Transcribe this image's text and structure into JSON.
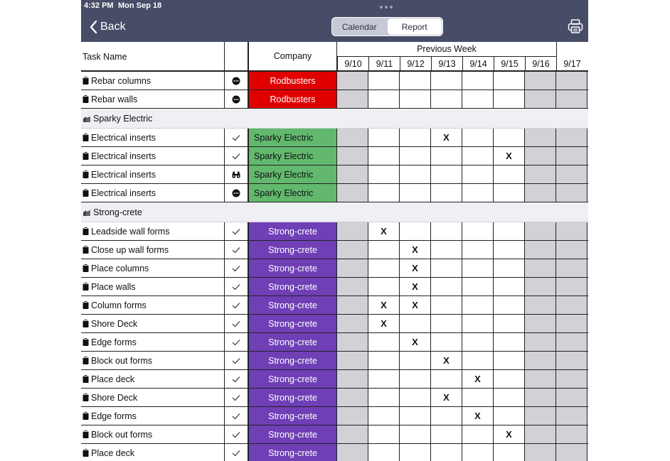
{
  "status_bar": {
    "time": "4:32 PM",
    "date": "Mon Sep 18"
  },
  "nav": {
    "back_label": "Back",
    "segments": [
      {
        "label": "Calendar",
        "active": false
      },
      {
        "label": "Report",
        "active": true
      }
    ],
    "print_icon": "printer-icon"
  },
  "table": {
    "task_header": "Task Name",
    "company_header": "Company",
    "week_header": "Previous Week",
    "days": [
      "9/10",
      "9/11",
      "9/12",
      "9/13",
      "9/14",
      "9/15",
      "9/16",
      "9/17"
    ],
    "shaded_days": [
      0,
      6,
      7
    ],
    "rows": [
      {
        "type": "task",
        "name": "Rebar columns",
        "status": "more",
        "company": "Rodbusters",
        "color": "#e00000",
        "marks": []
      },
      {
        "type": "task",
        "name": "Rebar walls",
        "status": "more",
        "company": "Rodbusters",
        "color": "#e00000",
        "marks": []
      },
      {
        "type": "group",
        "name": "Sparky Electric"
      },
      {
        "type": "task",
        "name": "Electrical inserts",
        "status": "check",
        "company": "Sparky Electric",
        "color": "#62b96e",
        "marks": [
          3
        ]
      },
      {
        "type": "task",
        "name": "Electrical inserts",
        "status": "check",
        "company": "Sparky Electric",
        "color": "#62b96e",
        "marks": [
          5
        ]
      },
      {
        "type": "task",
        "name": "Electrical inserts",
        "status": "binoculars",
        "company": "Sparky Electric",
        "color": "#62b96e",
        "marks": []
      },
      {
        "type": "task",
        "name": "Electrical inserts",
        "status": "more",
        "company": "Sparky Electric",
        "color": "#62b96e",
        "marks": []
      },
      {
        "type": "group",
        "name": "Strong-crete"
      },
      {
        "type": "task",
        "name": "Leadside wall forms",
        "status": "check",
        "company": "Strong-crete",
        "color": "#6f3fb6",
        "marks": [
          1
        ]
      },
      {
        "type": "task",
        "name": "Close up wall forms",
        "status": "check",
        "company": "Strong-crete",
        "color": "#6f3fb6",
        "marks": [
          2
        ]
      },
      {
        "type": "task",
        "name": "Place columns",
        "status": "check",
        "company": "Strong-crete",
        "color": "#6f3fb6",
        "marks": [
          2
        ]
      },
      {
        "type": "task",
        "name": "Place walls",
        "status": "check",
        "company": "Strong-crete",
        "color": "#6f3fb6",
        "marks": [
          2
        ]
      },
      {
        "type": "task",
        "name": "Column forms",
        "status": "check",
        "company": "Strong-crete",
        "color": "#6f3fb6",
        "marks": [
          1,
          2
        ]
      },
      {
        "type": "task",
        "name": "Shore Deck",
        "status": "check",
        "company": "Strong-crete",
        "color": "#6f3fb6",
        "marks": [
          1
        ]
      },
      {
        "type": "task",
        "name": "Edge forms",
        "status": "check",
        "company": "Strong-crete",
        "color": "#6f3fb6",
        "marks": [
          2
        ]
      },
      {
        "type": "task",
        "name": "Block out forms",
        "status": "check",
        "company": "Strong-crete",
        "color": "#6f3fb6",
        "marks": [
          3
        ]
      },
      {
        "type": "task",
        "name": "Place deck",
        "status": "check",
        "company": "Strong-crete",
        "color": "#6f3fb6",
        "marks": [
          4
        ]
      },
      {
        "type": "task",
        "name": "Shore Deck",
        "status": "check",
        "company": "Strong-crete",
        "color": "#6f3fb6",
        "marks": [
          3
        ]
      },
      {
        "type": "task",
        "name": "Edge forms",
        "status": "check",
        "company": "Strong-crete",
        "color": "#6f3fb6",
        "marks": [
          4
        ]
      },
      {
        "type": "task",
        "name": "Block out forms",
        "status": "check",
        "company": "Strong-crete",
        "color": "#6f3fb6",
        "marks": [
          5
        ]
      },
      {
        "type": "task",
        "name": "Place deck",
        "status": "check",
        "company": "Strong-crete",
        "color": "#6f3fb6",
        "marks": []
      }
    ],
    "mark_text": "X"
  }
}
